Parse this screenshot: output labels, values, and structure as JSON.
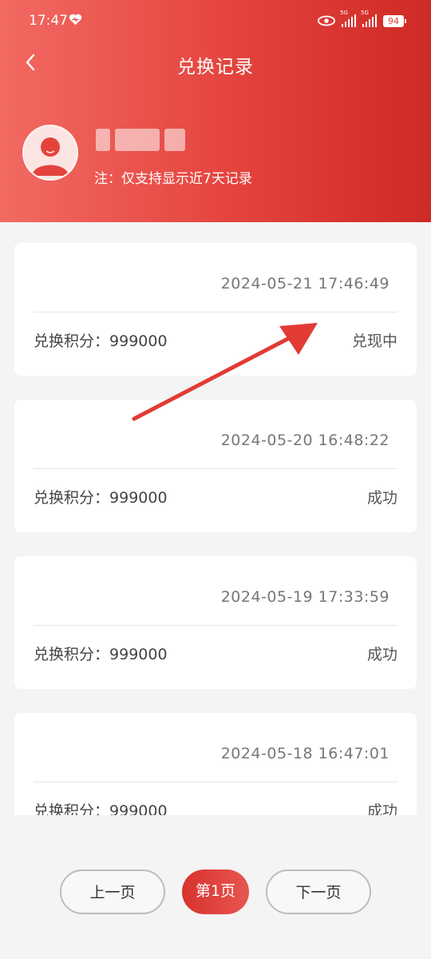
{
  "status_bar": {
    "time": "17:47",
    "sim1_label": "5G",
    "sim2_label": "5G",
    "battery": "94"
  },
  "header": {
    "title": "兑换记录",
    "note": "注：仅支持显示近7天记录"
  },
  "records": [
    {
      "time": "2024-05-21 17:46:49",
      "points_label": "兑换积分：",
      "points": "999000",
      "status": "兑现中"
    },
    {
      "time": "2024-05-20 16:48:22",
      "points_label": "兑换积分：",
      "points": "999000",
      "status": "成功"
    },
    {
      "time": "2024-05-19 17:33:59",
      "points_label": "兑换积分：",
      "points": "999000",
      "status": "成功"
    },
    {
      "time": "2024-05-18 16:47:01",
      "points_label": "兑换积分：",
      "points": "999000",
      "status": "成功"
    }
  ],
  "pagination": {
    "prev_label": "上一页",
    "current_label": "第1页",
    "next_label": "下一页"
  },
  "colors": {
    "brand_red": "#e4433d",
    "arrow_red": "#e23b35"
  }
}
